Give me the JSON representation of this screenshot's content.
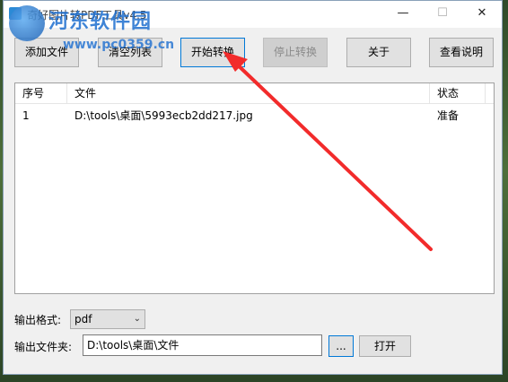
{
  "window": {
    "title": "奇好图片转PDF工具v4.5",
    "controls": {
      "minimize": "—",
      "maximize": "☐",
      "close": "✕"
    }
  },
  "watermark": {
    "site_name": "河东软件园",
    "url": "www.pc0359.cn"
  },
  "toolbar": {
    "add_files": "添加文件",
    "clear_list": "清空列表",
    "start_convert": "开始转换",
    "stop_convert": "停止转换",
    "about": "关于",
    "help": "查看说明"
  },
  "file_list": {
    "columns": [
      "序号",
      "文件",
      "状态"
    ],
    "rows": [
      {
        "index": "1",
        "file": "D:\\tools\\桌面\\5993ecb2dd217.jpg",
        "status": "准备"
      }
    ]
  },
  "output": {
    "format_label": "输出格式:",
    "format_value": "pdf",
    "folder_label": "输出文件夹:",
    "folder_path": "D:\\tools\\桌面\\文件",
    "browse_label": "...",
    "open_label": "打开"
  },
  "colors": {
    "annotation_arrow": "#f22b2b",
    "watermark": "#1e6fd0"
  }
}
